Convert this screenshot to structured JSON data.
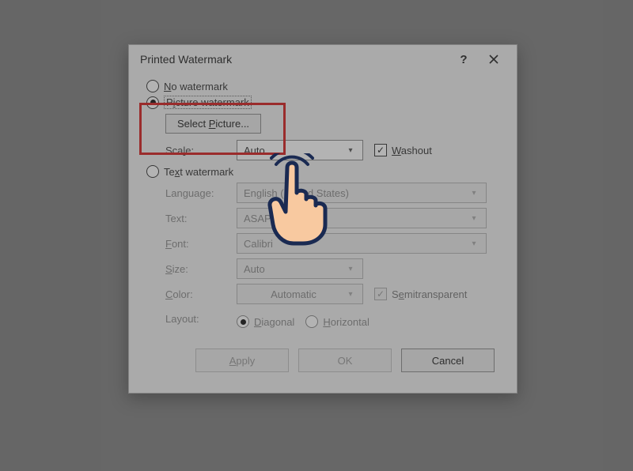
{
  "dialog": {
    "title": "Printed Watermark",
    "help": "?",
    "close": "×"
  },
  "options": {
    "none": {
      "label_pre": "N",
      "label_post": "o watermark"
    },
    "picture": {
      "label_pre": "P",
      "label_mid": "i",
      "label_post": "cture watermark"
    },
    "text": {
      "label_pre": "Te",
      "label_u": "x",
      "label_post": "t watermark"
    }
  },
  "picture": {
    "select_btn_pre": "Select ",
    "select_btn_u": "P",
    "select_btn_post": "icture...",
    "scale_label_pre": "Sca",
    "scale_label_u": "l",
    "scale_label_post": "e:",
    "scale_value": "Auto",
    "washout_u": "W",
    "washout_post": "ashout"
  },
  "textw": {
    "language_label": "Language:",
    "language_value": "English (United States)",
    "text_label_pre": "Te",
    "text_label_post": "xt:",
    "text_value": "ASAP",
    "font_label_pre": "",
    "font_label_u": "F",
    "font_label_post": "ont:",
    "font_value": "Calibri",
    "size_label_pre": "",
    "size_label_u": "S",
    "size_label_post": "ize:",
    "size_value": "Auto",
    "color_label_pre": "",
    "color_label_u": "C",
    "color_label_post": "olor:",
    "color_value": "Automatic",
    "semi_label_pre": "S",
    "semi_label_u": "e",
    "semi_label_post": "mitransparent",
    "layout_label": "Layout:",
    "diag_label_pre": "",
    "diag_label_u": "D",
    "diag_label_post": "iagonal",
    "horiz_label_pre": "",
    "horiz_label_u": "H",
    "horiz_label_post": "orizontal"
  },
  "buttons": {
    "apply_u": "A",
    "apply_post": "pply",
    "ok": "OK",
    "cancel": "Cancel"
  }
}
